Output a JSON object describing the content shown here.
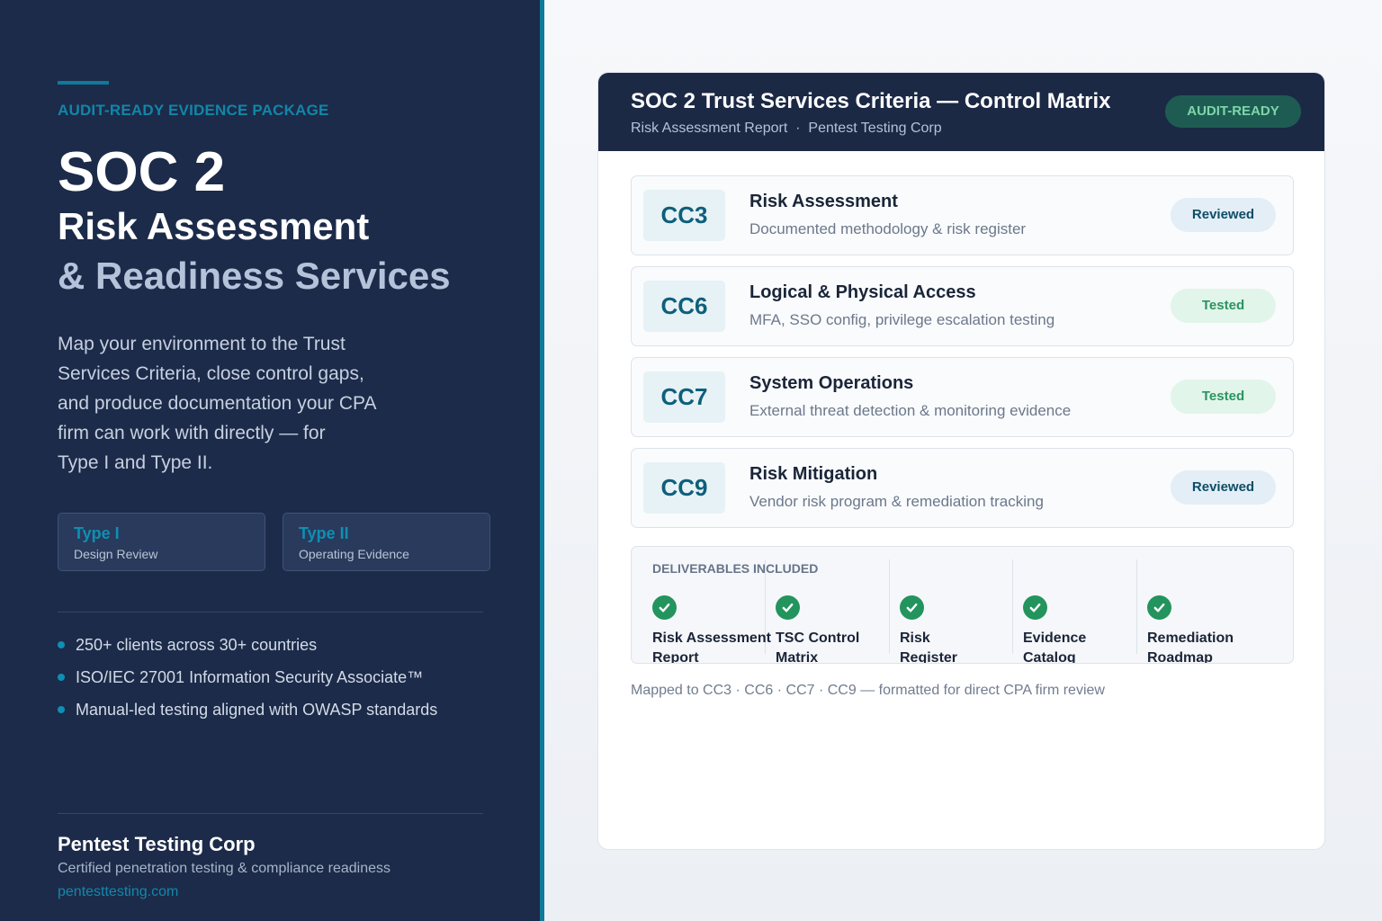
{
  "left": {
    "eyebrow": "AUDIT-READY EVIDENCE PACKAGE",
    "headline": "SOC 2",
    "subhead_1": "Risk Assessment",
    "subhead_2": "& Readiness Services",
    "intro_lines": [
      "Map your environment to the Trust",
      "Services Criteria, close control gaps,",
      "and produce documentation your CPA",
      "firm can work with directly — for",
      "Type I and Type II."
    ],
    "types": [
      {
        "title": "Type I",
        "subtitle": "Design Review"
      },
      {
        "title": "Type II",
        "subtitle": "Operating Evidence"
      }
    ],
    "bullets": [
      "250+ clients across 30+ countries",
      "ISO/IEC 27001 Information Security Associate™",
      "Manual-led testing aligned with OWASP standards"
    ],
    "company": "Pentest Testing Corp",
    "tagline": "Certified penetration testing & compliance readiness",
    "website": "pentesttesting.com"
  },
  "matrix": {
    "title": "SOC 2 Trust Services Criteria — Control Matrix",
    "subtitle_report": "Risk Assessment Report",
    "subtitle_sep": "·",
    "subtitle_company": "Pentest Testing Corp",
    "badge": "AUDIT-READY",
    "controls": [
      {
        "code": "CC3",
        "title": "Risk Assessment",
        "description": "Documented methodology & risk register",
        "status": "Reviewed"
      },
      {
        "code": "CC6",
        "title": "Logical & Physical Access",
        "description": "MFA, SSO config, privilege escalation testing",
        "status": "Tested"
      },
      {
        "code": "CC7",
        "title": "System Operations",
        "description": "External threat detection & monitoring evidence",
        "status": "Tested"
      },
      {
        "code": "CC9",
        "title": "Risk Mitigation",
        "description": "Vendor risk program & remediation tracking",
        "status": "Reviewed"
      }
    ],
    "deliverables_heading": "DELIVERABLES INCLUDED",
    "deliverables": [
      {
        "line1": "Risk Assessment",
        "line2": "Report"
      },
      {
        "line1": "TSC Control",
        "line2": "Matrix"
      },
      {
        "line1": "Risk",
        "line2": "Register"
      },
      {
        "line1": "Evidence",
        "line2": "Catalog"
      },
      {
        "line1": "Remediation",
        "line2": "Roadmap"
      }
    ],
    "footnote": "Mapped to CC3 · CC6 · CC7 · CC9  —  formatted for direct CPA firm review"
  },
  "colors": {
    "navy": "#1c2b49",
    "teal_accent": "#0f7a99",
    "reviewed_text": "#0e4d66",
    "tested_text": "#2a9460",
    "audit_ready_bg": "#1e5c53",
    "check_green": "#23945d"
  },
  "icons": {
    "bullet": "dot-icon",
    "deliverable": "check-circle-icon"
  }
}
